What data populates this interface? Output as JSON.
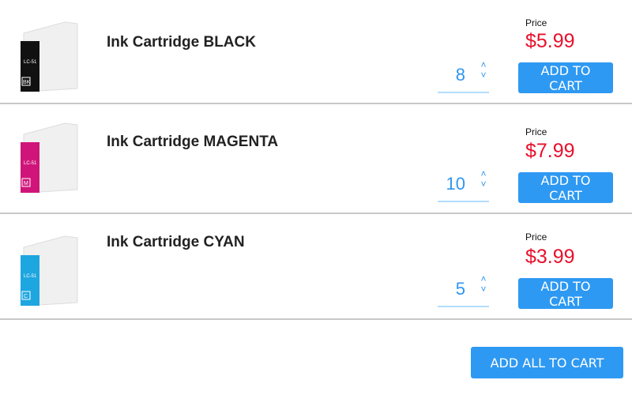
{
  "products": [
    {
      "name": "Ink Cartridge BLACK",
      "price_label": "Price",
      "price": "$5.99",
      "quantity": "8",
      "button": "ADD TO CART",
      "ink_color": "#111111",
      "badge": "BK",
      "model": "LC-51",
      "color_name": "Black"
    },
    {
      "name": "Ink Cartridge MAGENTA",
      "price_label": "Price",
      "price": "$7.99",
      "quantity": "10",
      "button": "ADD TO CART",
      "ink_color": "#d0157a",
      "badge": "M",
      "model": "LC-51",
      "color_name": "Magenta"
    },
    {
      "name": "Ink Cartridge CYAN",
      "price_label": "Price",
      "price": "$3.99",
      "quantity": "5",
      "button": "ADD TO CART",
      "ink_color": "#1ea6e0",
      "badge": "C",
      "model": "LC-51",
      "color_name": "Cyan"
    }
  ],
  "footer": {
    "add_all_label": "ADD ALL TO CART"
  },
  "icons": {
    "up": "˄",
    "down": "˅"
  }
}
